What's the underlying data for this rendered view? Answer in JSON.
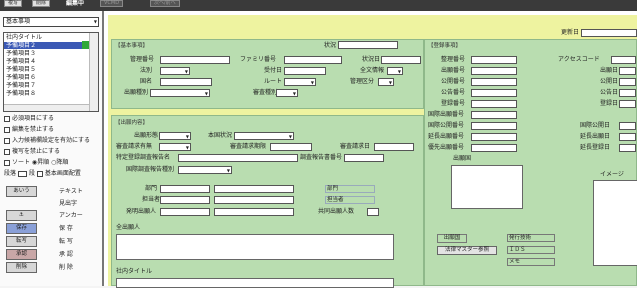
{
  "topbar": {
    "btn1": "複写",
    "btn2": "削除",
    "mode": "編集中",
    "btn3": "VCMD",
    "btn4": "次へ/前へ"
  },
  "left": {
    "top_select": "基本事項",
    "list": [
      "社内タイトル",
      "予備項目２",
      "予備項目３",
      "予備項目４",
      "予備項目５",
      "予備項目６",
      "予備項目７",
      "予備項目８"
    ],
    "checks": [
      "必須項目にする",
      "編集を禁止する",
      "入力候補欄設定を有効にする",
      "複写を禁止にする"
    ],
    "sort": {
      "label": "ソート",
      "opt1": "昇順",
      "opt2": "降順"
    },
    "row": {
      "a": "段落",
      "b": "段",
      "c": "基本画面配置"
    },
    "buttons": [
      {
        "btn": "あいう",
        "label": "テキスト"
      },
      {
        "btn": "",
        "label": "見出字"
      },
      {
        "btn": "⚓",
        "label": "アンカー"
      },
      {
        "btn": "保存",
        "label": "保 存"
      },
      {
        "btn": "転写",
        "label": "転 写"
      },
      {
        "btn": "承認",
        "label": "承 認"
      },
      {
        "btn": "削除",
        "label": "削 除"
      }
    ]
  },
  "main": {
    "update_label": "更新日",
    "basic": {
      "title": "【基本事項】",
      "status": "状況",
      "seiri": "管理番号",
      "family": "ファミリ番号",
      "joukyou": "状況日",
      "houbetsu": "法別",
      "nenpyo": "受付日",
      "zenbun": "全文情報",
      "kuni": "国名",
      "route": "ルート",
      "kanri_kubun": "管理区分",
      "shutsugan": "出願種別",
      "shinsa": "審査種別"
    },
    "detail": {
      "title": "【出願内容】",
      "shutsugan_keitai": "出願形態",
      "honkoku": "本国状況",
      "shinsa_seikyu": "審査請求期限",
      "shinsa_seikyu2": "審査請求日",
      "shinsa_seikyu_flag": "審査請求有無",
      "tokutei": "特定登録調査報告名",
      "chousa": "調査報告書番号",
      "kokusai": "国際調査報告種別",
      "busho": "部門",
      "busho_v": "部門",
      "tantou": "担当者",
      "tantou_v": "担当者",
      "hatsumei": "発明出願人",
      "kyoudou": "共同出願人数",
      "zen": "全出願人",
      "shanai": "社内タイトル"
    },
    "register": {
      "title": "【登録事項】",
      "seiri": "整理番号",
      "access": "アクセスコード",
      "shutsugan_no": "出願番号",
      "shutsugan_d": "出願日",
      "koukai_no": "公開番号",
      "koukai_d": "公開日",
      "kouhou_no": "公告番号",
      "kouhou_d": "公告日",
      "touroku_no": "登録番号",
      "touroku_d": "登録日",
      "kokusai_shutsugan": "国際出願番号",
      "kokusai_koukai": "国際公開番号",
      "kokusai_koukai_d": "国際公開日",
      "enchou": "延長出願番号",
      "enchou_d": "延長出願日",
      "yuusen": "優先出願番号",
      "yuusen_d": "延長登録日",
      "shutsugan_kuni": "出願国",
      "image": "イメージ",
      "shutsugan_btn": "出願国",
      "master_btn": "法律マスター参照",
      "m1": "発行技術",
      "m2": "ＩＤＳ",
      "m3": "メモ"
    }
  }
}
